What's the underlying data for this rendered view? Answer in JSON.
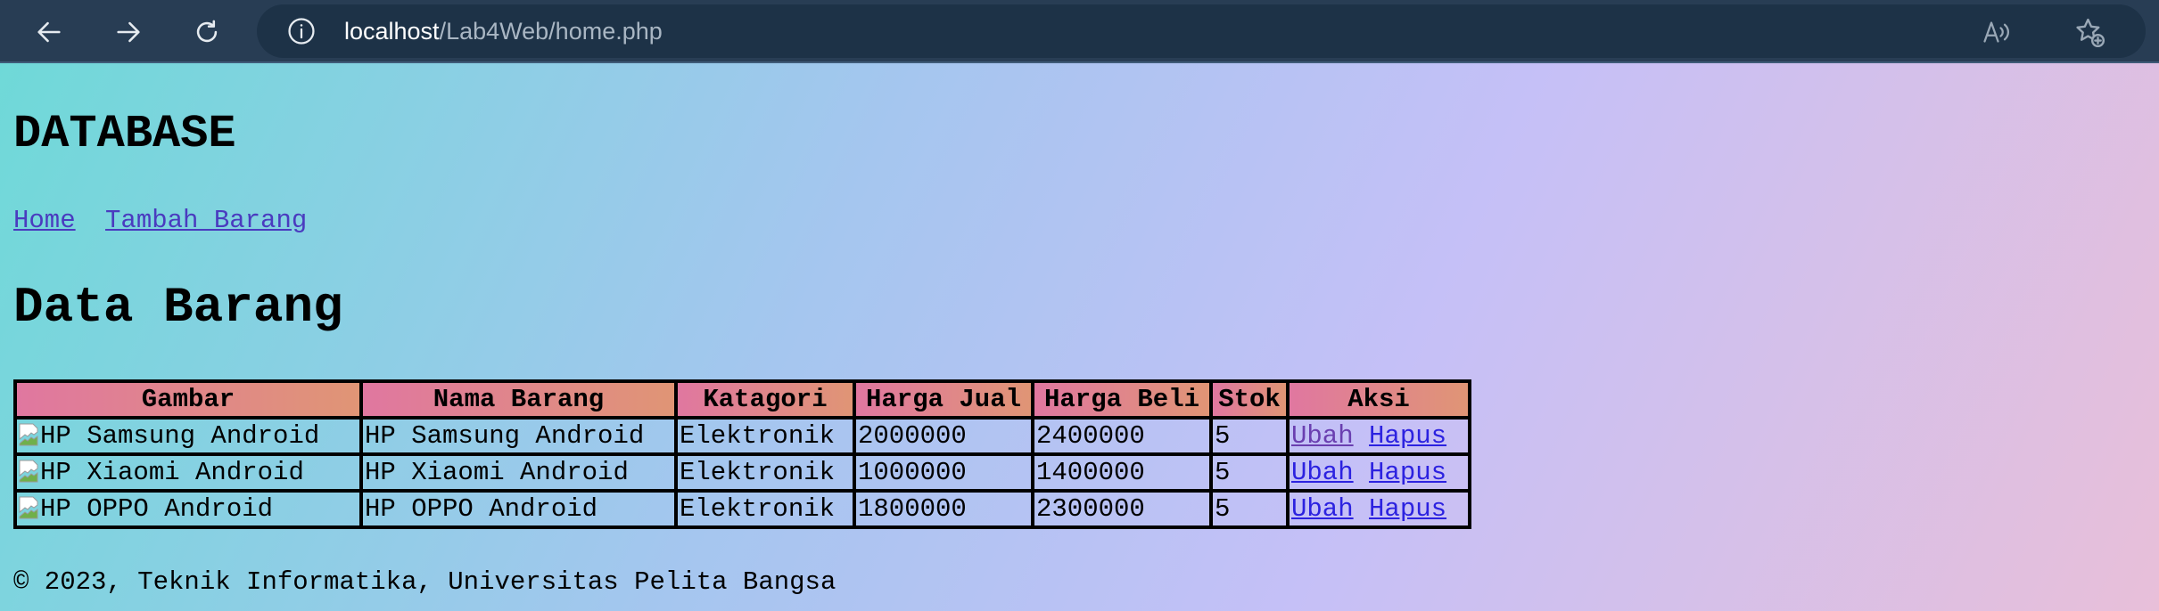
{
  "browser": {
    "url_host": "localhost",
    "url_path": "/Lab4Web/home.php"
  },
  "page": {
    "title": "DATABASE",
    "menu": [
      "Home",
      "Tambah Barang"
    ],
    "subtitle": "Data Barang",
    "table": {
      "headers": [
        "Gambar",
        "Nama Barang",
        "Katagori",
        "Harga Jual",
        "Harga Beli",
        "Stok",
        "Aksi"
      ],
      "rows": [
        {
          "gambar_alt": "HP Samsung Android",
          "nama": "HP Samsung Android",
          "kategori": "Elektronik",
          "harga_jual": "2000000",
          "harga_beli": "2400000",
          "stok": "5",
          "ubah": "Ubah",
          "hapus": "Hapus"
        },
        {
          "gambar_alt": "HP Xiaomi Android",
          "nama": "HP Xiaomi Android",
          "kategori": "Elektronik",
          "harga_jual": "1000000",
          "harga_beli": "1400000",
          "stok": "5",
          "ubah": "Ubah",
          "hapus": "Hapus"
        },
        {
          "gambar_alt": "HP OPPO Android",
          "nama": "HP OPPO Android",
          "kategori": "Elektronik",
          "harga_jual": "1800000",
          "harga_beli": "2300000",
          "stok": "5",
          "ubah": "Ubah",
          "hapus": "Hapus"
        }
      ]
    },
    "footer": "© 2023, Teknik Informatika, Universitas Pelita Bangsa"
  }
}
